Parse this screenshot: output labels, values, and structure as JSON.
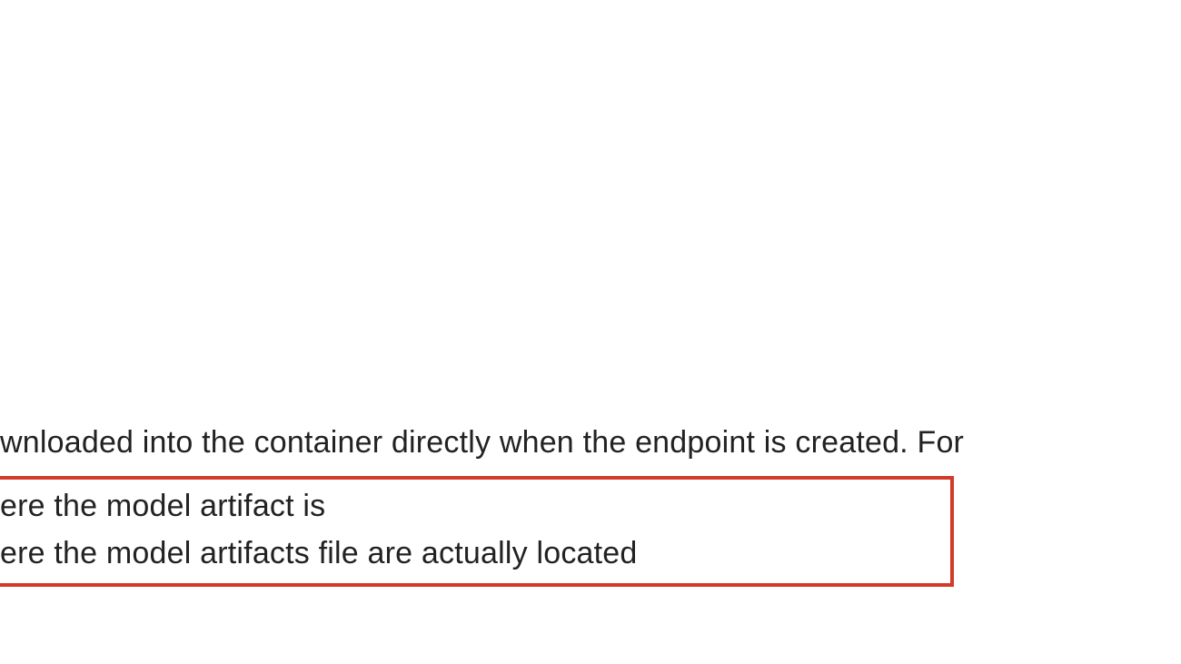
{
  "paragraph": {
    "line1": "wnloaded into the container directly when the endpoint is created. For",
    "box": {
      "line2": "ere the model artifact is",
      "line3": "ere the model artifacts file are actually located"
    }
  },
  "colors": {
    "highlight_border": "#d23b2a",
    "text": "#222222",
    "background": "#ffffff"
  }
}
